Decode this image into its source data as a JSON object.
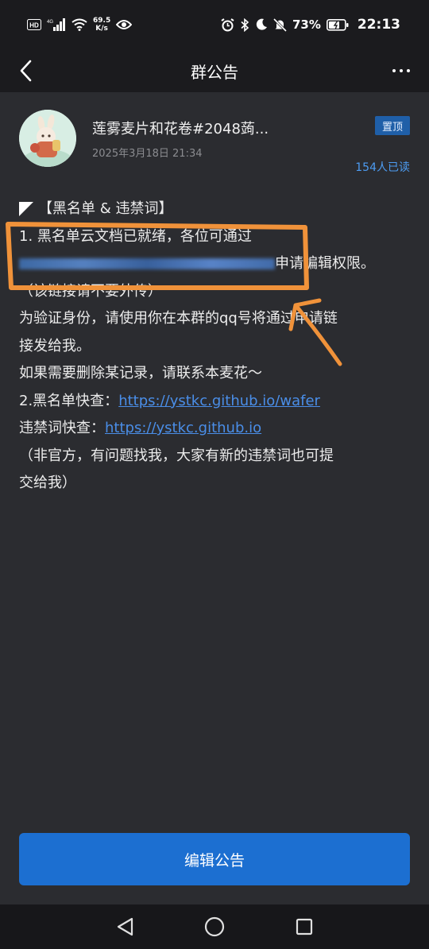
{
  "status_bar": {
    "carrier_badge": "HD",
    "network": "4G",
    "speed_value": "69.5",
    "speed_unit": "K/s",
    "battery_percent": "73%",
    "time": "22:13"
  },
  "nav": {
    "title": "群公告"
  },
  "post": {
    "group_name": "莲雾麦片和花卷#2048蒟...",
    "timestamp": "2025年3月18日 21:34",
    "pin_label": "置顶",
    "read_count": "154人已读"
  },
  "announcement": {
    "title": "【黑名单 & 违禁词】",
    "line1": "1. 黑名单云文档已就绪，各位可通过",
    "line2_suffix": "申请编辑权限。",
    "line3": "（该链接请不要外传）",
    "line4": "为验证身份，请使用你在本群的qq号将通过申请链",
    "line5": "接发给我。",
    "line6": "如果需要删除某记录，请联系本麦花～",
    "line7_prefix": "2.黑名单快查：",
    "blacklist_link": "https://ystkc.github.io/wafer",
    "line8_prefix": "违禁词快查：",
    "banned_words_link": "https://ystkc.github.io",
    "line9": "（非官方，有问题找我，大家有新的违禁词也可提",
    "line10": "交给我）"
  },
  "actions": {
    "edit_label": "编辑公告"
  },
  "colors": {
    "background": "#2b2c30",
    "accent_blue": "#1c6fd1",
    "link_blue": "#4a8ee8",
    "annotation_orange": "#f0923a"
  }
}
